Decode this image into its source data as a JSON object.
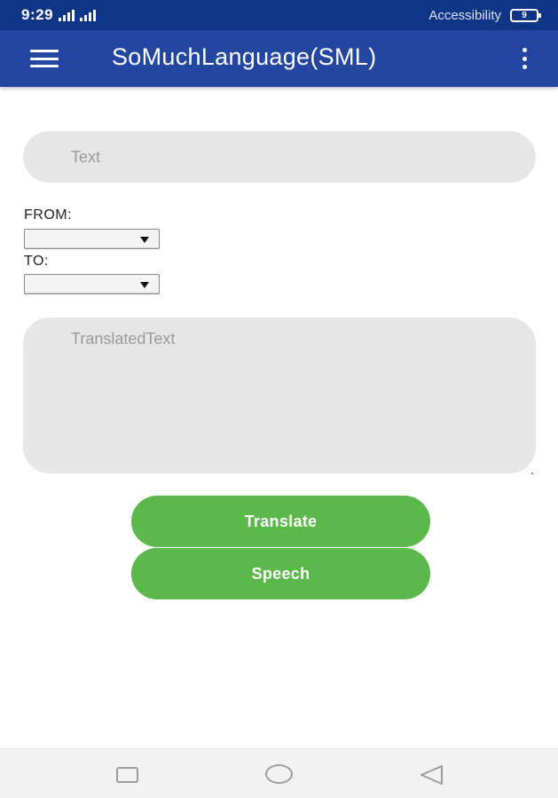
{
  "status_bar": {
    "time": "9:29",
    "accessibility": "Accessibility",
    "battery_level": "9"
  },
  "app_bar": {
    "title": "SoMuchLanguage(SML)"
  },
  "form": {
    "text_placeholder": "Text",
    "from_label": "FROM:",
    "from_value": "",
    "to_label": "TO:",
    "to_value": "",
    "translated_placeholder": "TranslatedText"
  },
  "buttons": {
    "translate": "Translate",
    "speech": "Speech"
  },
  "colors": {
    "status_bar": "#0f3586",
    "app_bar": "#2347a1",
    "button": "#5bb84a",
    "field": "#e6e6e6"
  },
  "icons": {
    "menu": "menu-icon",
    "overflow": "more-vert-icon",
    "nav_recents": "square-icon",
    "nav_home": "circle-icon",
    "nav_back": "triangle-back-icon"
  }
}
